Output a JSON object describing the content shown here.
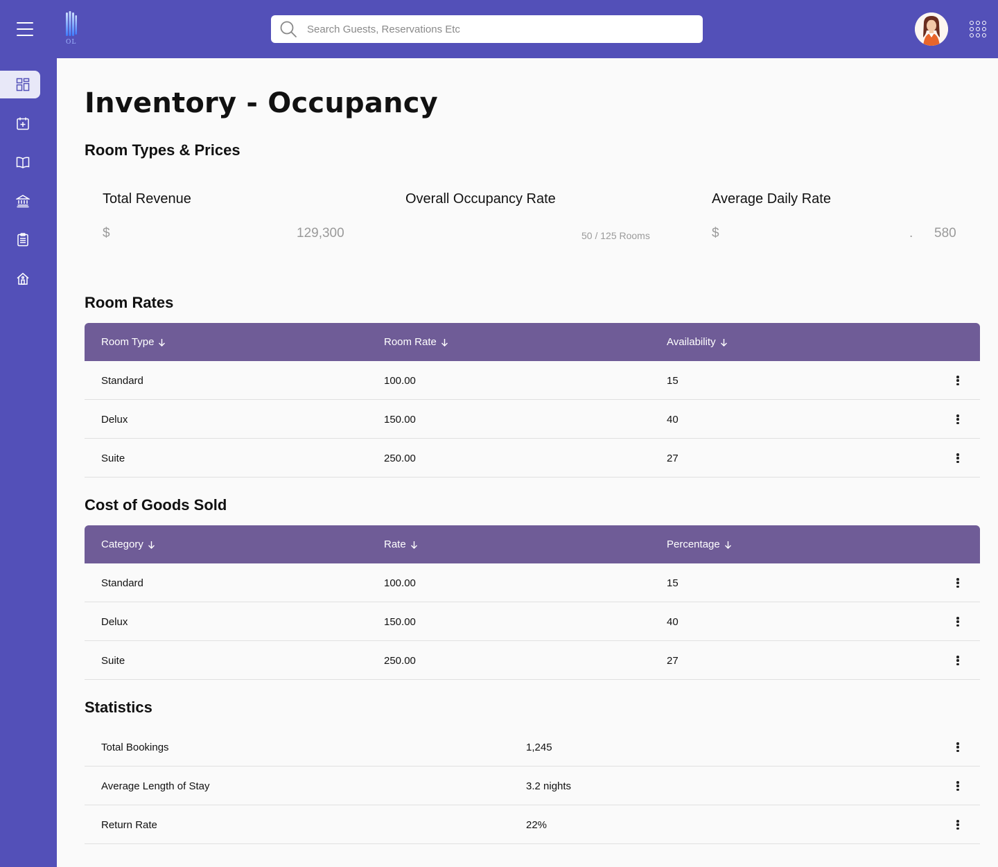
{
  "header": {
    "logo_text": "OL",
    "search_placeholder": "Search Guests, Reservations Etc"
  },
  "page": {
    "title": "Inventory - Occupancy",
    "section_room_types": "Room Types & Prices",
    "section_room_rates": "Room Rates",
    "section_cogs": "Cost of Goods Sold",
    "section_statistics": "Statistics"
  },
  "stats": {
    "total_revenue": {
      "label": "Total Revenue",
      "currency": "$",
      "value": "129,300"
    },
    "occupancy": {
      "label": "Overall Occupancy Rate",
      "value": "50 / 125 Rooms"
    },
    "adr": {
      "label": "Average Daily Rate",
      "currency": "$",
      "separator": ".",
      "value": "580"
    }
  },
  "room_rates": {
    "headers": [
      "Room Type",
      "Room Rate",
      "Availability"
    ],
    "rows": [
      [
        "Standard",
        "100.00",
        "15"
      ],
      [
        "Delux",
        "150.00",
        "40"
      ],
      [
        "Suite",
        "250.00",
        "27"
      ]
    ]
  },
  "cogs": {
    "headers": [
      "Category",
      "Rate",
      "Percentage"
    ],
    "rows": [
      [
        "Standard",
        "100.00",
        "15"
      ],
      [
        "Delux",
        "150.00",
        "40"
      ],
      [
        "Suite",
        "250.00",
        "27"
      ]
    ]
  },
  "statistics": {
    "rows": [
      [
        "Total Bookings",
        "1,245"
      ],
      [
        "Average Length of Stay",
        "3.2 nights"
      ],
      [
        "Return Rate",
        "22%"
      ]
    ]
  },
  "colors": {
    "primary": "#5350b8",
    "table_header": "#6f5c97"
  },
  "icons": {
    "menu": "hamburger-menu-icon",
    "search": "search-icon",
    "apps": "apps-grid-icon",
    "sort": "arrow-down-icon",
    "row_actions": "more-vertical-icon",
    "nav": [
      "dashboard-icon",
      "calendar-add-icon",
      "book-icon",
      "bank-icon",
      "clipboard-icon",
      "home-icon"
    ]
  }
}
